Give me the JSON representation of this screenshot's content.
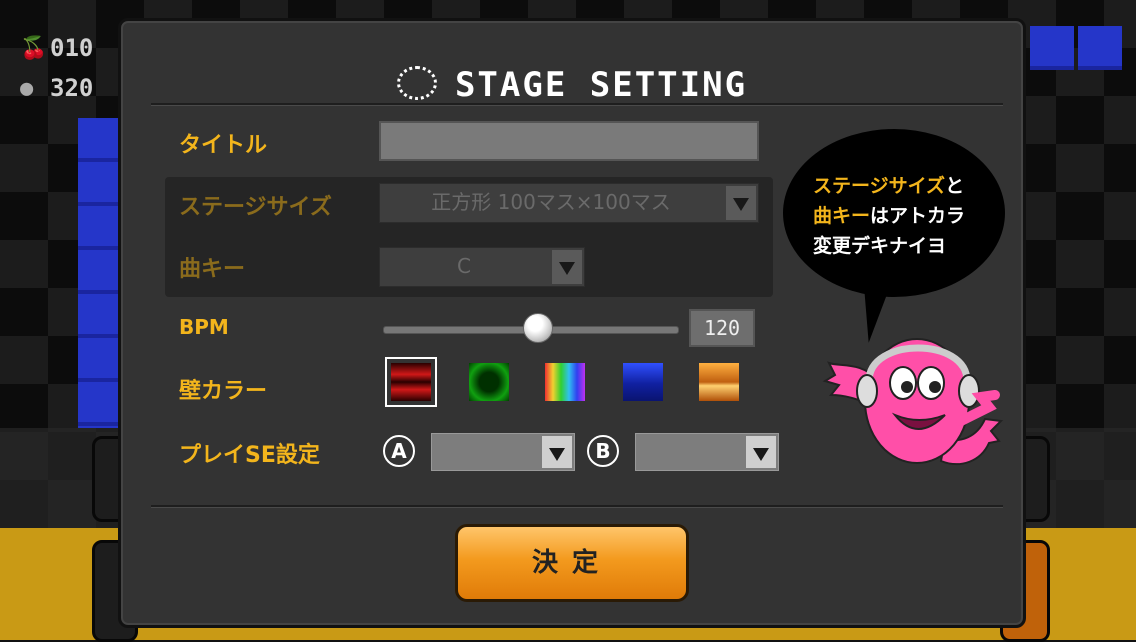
{
  "hud": {
    "cherries": "010",
    "score": "320"
  },
  "dialog": {
    "title": "STAGE SETTING",
    "title_label": "タイトル",
    "title_value": "",
    "stage_size_label": "ステージサイズ",
    "stage_size_value": "正方形 100マス×100マス",
    "song_key_label": "曲キー",
    "song_key_value": "C",
    "bpm_label": "BPM",
    "bpm_value": "120",
    "bpm_level": 0.52,
    "wall_color_label": "壁カラー",
    "wall_colors": [
      "red",
      "green",
      "rainbow",
      "blue",
      "gold"
    ],
    "wall_color_selected": 0,
    "play_se_label": "プレイSE設定",
    "se_a_label": "A",
    "se_b_label": "B",
    "se_a_value": "",
    "se_b_value": "",
    "ok_label": "決定"
  },
  "bubble": {
    "line1_hl": "ステージサイズ",
    "line1_rest": "と",
    "line2_hl": "曲キー",
    "line2_rest": "はアトカラ",
    "line3": "変更デキナイヨ"
  },
  "colors": {
    "accent": "#f3b51c",
    "dialog_bg": "#333333",
    "button": "#f39a1e"
  }
}
